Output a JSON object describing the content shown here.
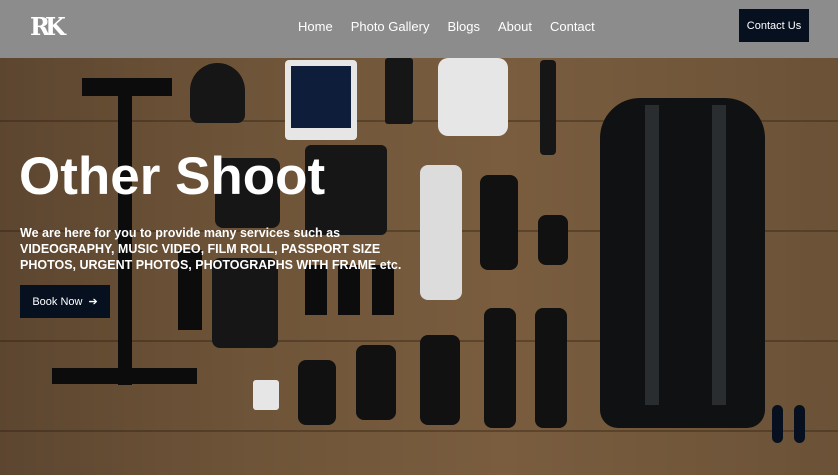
{
  "nav": {
    "logo_text": "RK",
    "links": [
      "Home",
      "Photo Gallery",
      "Blogs",
      "About",
      "Contact"
    ],
    "cta": "Contact Us"
  },
  "hero": {
    "title": "Other Shoot",
    "description": "We are here for you to provide many services such as VIDEOGRAPHY, MUSIC VIDEO, FILM ROLL, PASSPORT SIZE PHOTOS, URGENT PHOTOS, PHOTOGRAPHS WITH FRAME etc.",
    "button": "Book Now",
    "button_icon": "arrow-right-icon"
  },
  "colors": {
    "nav_bg": "#8c8c8c",
    "button_bg": "#06101f"
  }
}
